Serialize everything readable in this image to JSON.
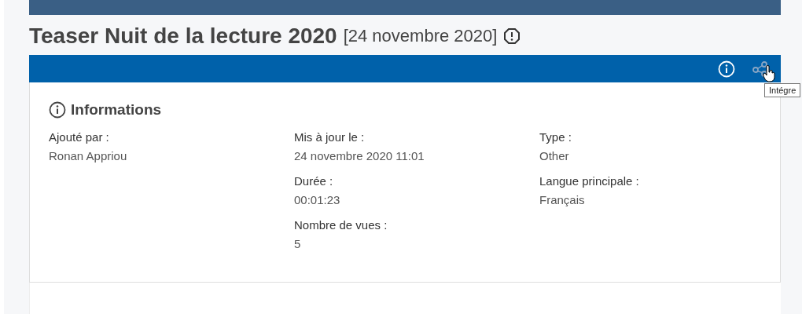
{
  "title": "Teaser Nuit de la lecture 2020",
  "date": "[24 novembre 2020]",
  "tooltip": "Intégre",
  "section": {
    "heading": "Informations",
    "columns": [
      [
        {
          "label": "Ajouté par :",
          "value": "Ronan Appriou"
        }
      ],
      [
        {
          "label": "Mis à jour le :",
          "value": "24 novembre 2020 11:01"
        },
        {
          "label": "Durée :",
          "value": "00:01:23"
        },
        {
          "label": "Nombre de vues :",
          "value": "5"
        }
      ],
      [
        {
          "label": "Type :",
          "value": "Other"
        },
        {
          "label": "Langue principale :",
          "value": "Français"
        }
      ]
    ]
  }
}
